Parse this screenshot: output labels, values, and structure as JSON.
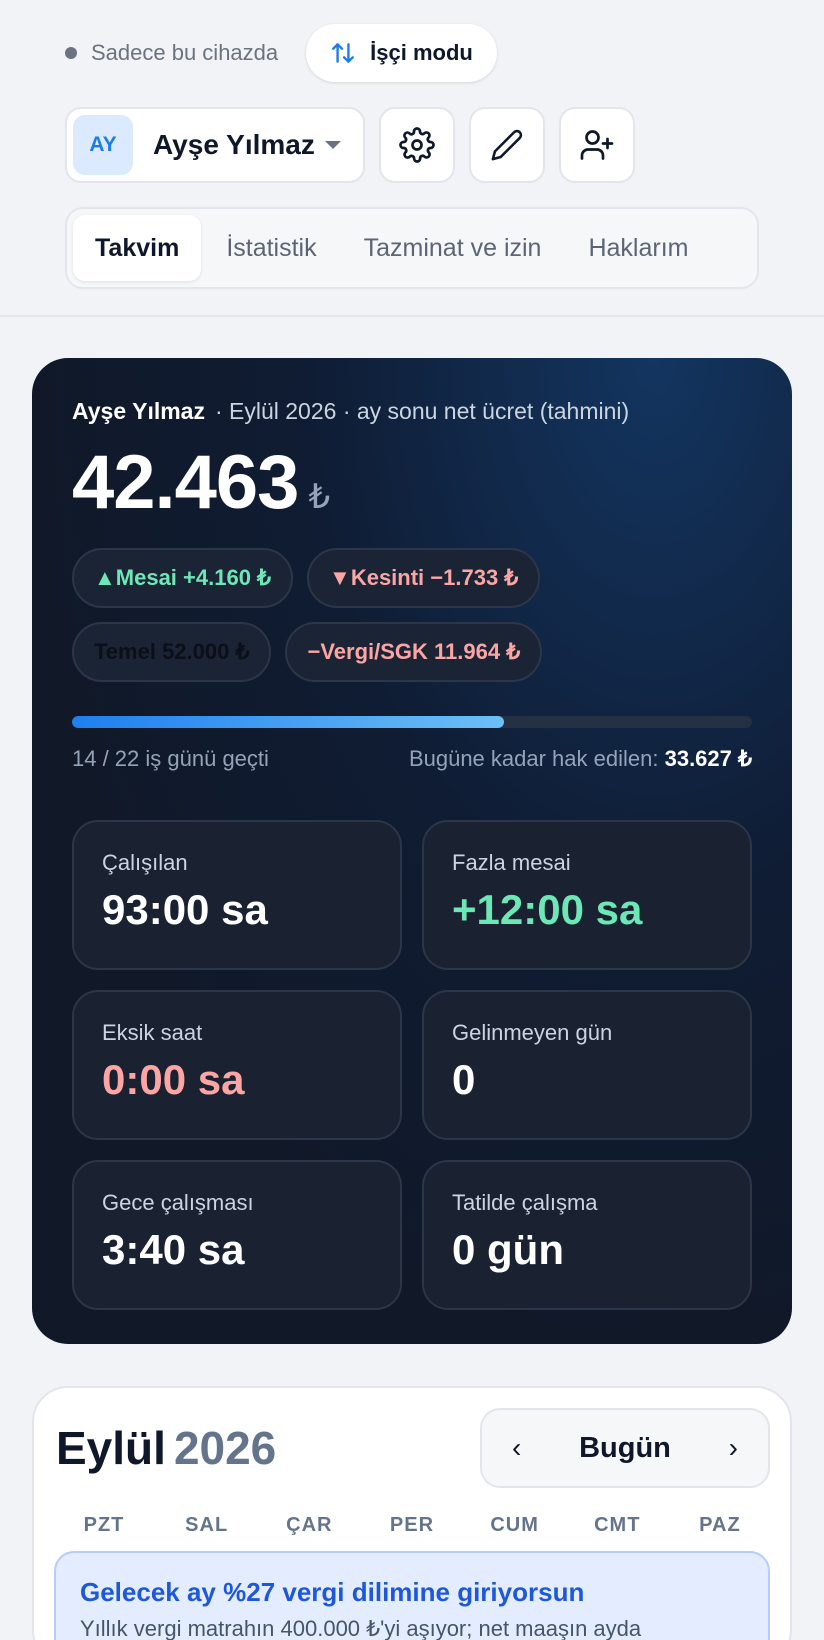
{
  "header": {
    "local_label": "Sadece bu cihazda",
    "mode_label": "İşçi modu",
    "user_initials": "AY",
    "user_name": "Ayşe Yılmaz"
  },
  "tabs": [
    {
      "label": "Takvim",
      "active": true
    },
    {
      "label": "İstatistik",
      "active": false
    },
    {
      "label": "Tazminat ve izin",
      "active": false
    },
    {
      "label": "Haklarım",
      "active": false
    }
  ],
  "summary": {
    "name": "Ayşe Yılmaz",
    "period": "· Eylül 2026 · ay sonu net ücret (tahmini)",
    "amount": "42.463",
    "currency": "₺",
    "chips": {
      "overtime": "▲Mesai +4.160 ₺",
      "deduction": "▼Kesinti −1.733 ₺",
      "base": "Temel 52.000 ₺",
      "tax": "−Vergi/SGK 11.964 ₺"
    },
    "progress_fraction": 0.636,
    "days_text": "14 / 22 iş günü geçti",
    "earned_label": "Bugüne kadar hak edilen:",
    "earned_value": "33.627 ₺"
  },
  "stats": [
    {
      "label": "Çalışılan",
      "value": "93:00 sa",
      "tone": "white"
    },
    {
      "label": "Fazla mesai",
      "value": "+12:00 sa",
      "tone": "green"
    },
    {
      "label": "Eksik saat",
      "value": "0:00 sa",
      "tone": "red"
    },
    {
      "label": "Gelinmeyen gün",
      "value": "0",
      "tone": "white"
    },
    {
      "label": "Gece çalışması",
      "value": "3:40 sa",
      "tone": "white"
    },
    {
      "label": "Tatilde çalışma",
      "value": "0 gün",
      "tone": "white"
    }
  ],
  "calendar": {
    "month": "Eylül",
    "year": "2026",
    "prev": "‹",
    "today": "Bugün",
    "next": "›",
    "weekdays": [
      "PZT",
      "SAL",
      "ÇAR",
      "PER",
      "CUM",
      "CMT",
      "PAZ"
    ],
    "notice_title": "Gelecek ay %27 vergi dilimine giriyorsun",
    "notice_text": "Yıllık vergi matrahın 400.000 ₺'yi aşıyor; net maaşın ayda"
  },
  "colors": {
    "accent": "#1d7ce8",
    "green": "#6ee7b7",
    "red": "#fca5a5"
  }
}
